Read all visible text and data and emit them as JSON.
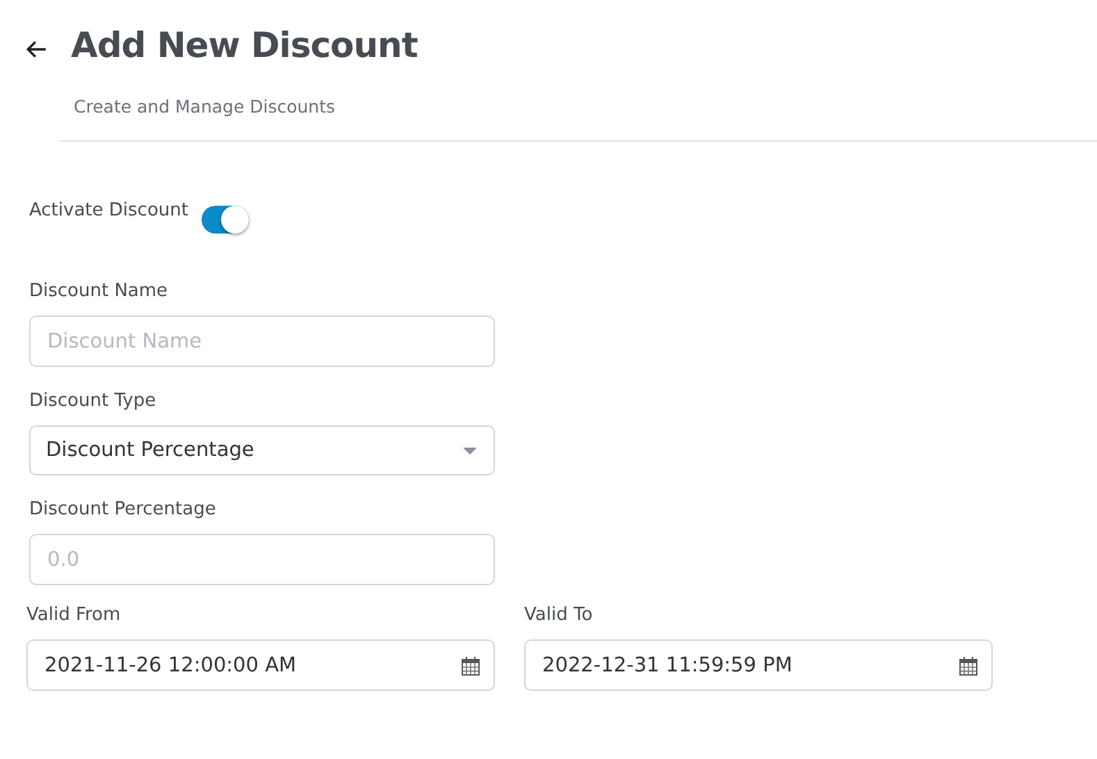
{
  "header": {
    "title": "Add New Discount",
    "subtitle": "Create and Manage Discounts"
  },
  "activate": {
    "label": "Activate Discount",
    "on": true
  },
  "fields": [
    {
      "kind": "text",
      "label": "Discount Name",
      "placeholder": "Discount Name"
    },
    {
      "kind": "select",
      "label": "Discount Type",
      "value": "Discount Percentage"
    },
    {
      "kind": "text",
      "label": "Discount Percentage",
      "placeholder": "0.0"
    }
  ],
  "dates": [
    {
      "label": "Valid From",
      "value": "2021-11-26 12:00:00 AM"
    },
    {
      "label": "Valid To",
      "value": "2022-12-31 11:59:59 PM"
    }
  ]
}
